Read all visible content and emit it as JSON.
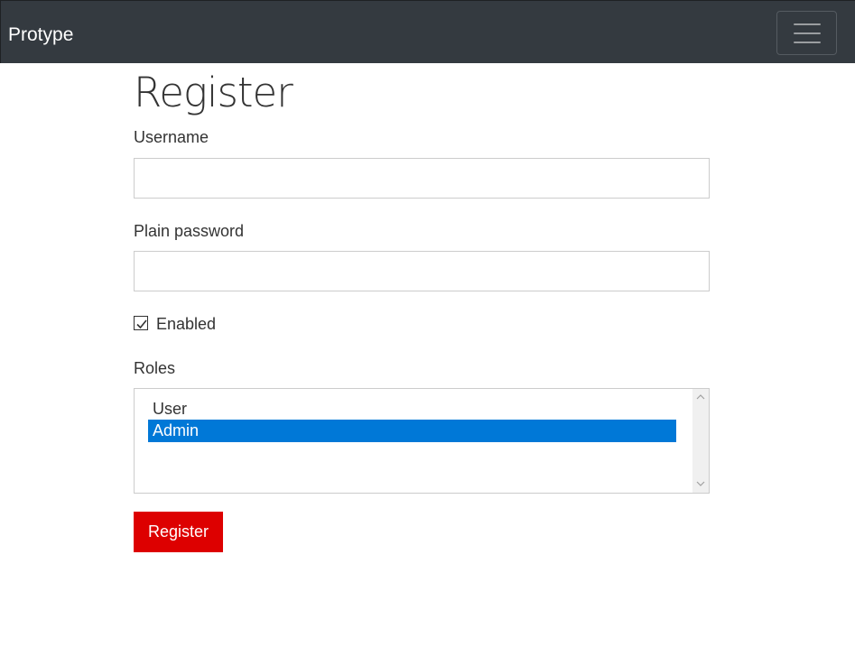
{
  "navbar": {
    "brand": "Protype"
  },
  "page": {
    "title": "Register"
  },
  "form": {
    "username": {
      "label": "Username",
      "value": ""
    },
    "password": {
      "label": "Plain password",
      "value": ""
    },
    "enabled": {
      "label": "Enabled",
      "checked": true
    },
    "roles": {
      "label": "Roles",
      "options": [
        {
          "label": "User",
          "selected": false
        },
        {
          "label": "Admin",
          "selected": true
        }
      ]
    },
    "submit_label": "Register"
  },
  "colors": {
    "navbar_bg": "#343a40",
    "submit_bg": "#dd0000",
    "selected_option_bg": "#0078d7"
  },
  "icons": {
    "menu": "hamburger-icon",
    "check": "checkmark-icon",
    "scroll_up": "chevron-up-icon",
    "scroll_down": "chevron-down-icon"
  }
}
